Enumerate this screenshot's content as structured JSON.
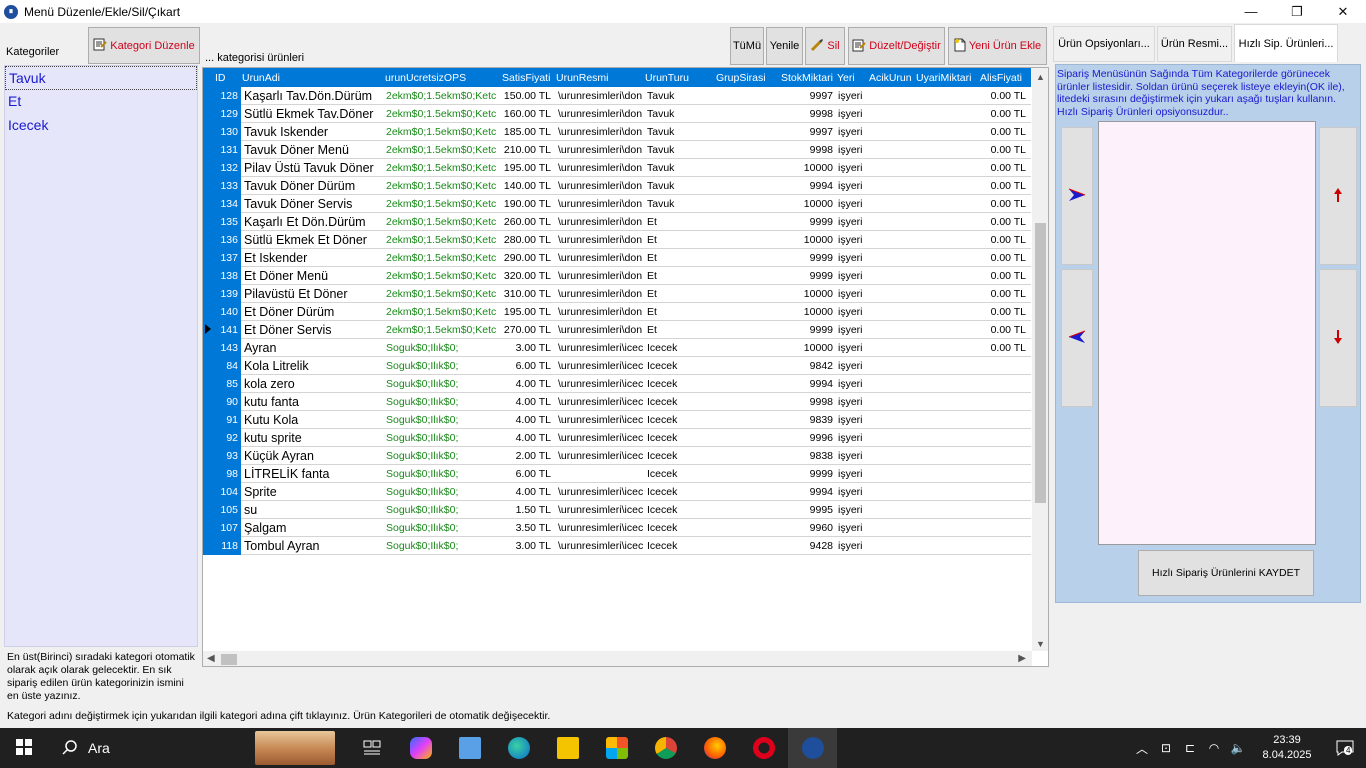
{
  "window": {
    "title": "Menü Düzenle/Ekle/Sil/Çıkart",
    "minimize": "—",
    "maximize": "❐",
    "close": "✕"
  },
  "left": {
    "label": "Kategoriler",
    "edit_button": "Kategori Düzenle",
    "categories": [
      "Tavuk",
      "Et",
      "Icecek"
    ],
    "note": "En üst(Birinci) sıradaki kategori otomatik olarak açık olarak gelecektir. En sık sipariş edilen ürün kategorinizin ismini en üste yazınız."
  },
  "products_label": "... kategorisi ürünleri",
  "toolbar": {
    "all": "TüMü",
    "refresh": "Yenile",
    "delete": "Sil",
    "edit": "Düzelt/Değiştir",
    "add": "Yeni Ürün Ekle"
  },
  "grid": {
    "columns": [
      "ID",
      "UrunAdi",
      "urunUcretsizOPS",
      "SatisFiyati",
      "UrunResmi",
      "UrunTuru",
      "GrupSirasi",
      "StokMiktari",
      "Yeri",
      "AcikUrun",
      "UyariMiktari",
      "AlisFiyati"
    ],
    "rows": [
      {
        "id": "128",
        "name": "Kaşarlı Tav.Dön.Dürüm",
        "ops": "2ekm$0;1.5ekm$0;Ketc",
        "price": "150.00 TL",
        "res": "\\urunresimleri\\don",
        "turu": "Tavuk",
        "stok": "9997",
        "yeri": "işyeri",
        "alis": "0.00 TL"
      },
      {
        "id": "129",
        "name": "Sütlü Ekmek Tav.Döner",
        "ops": "2ekm$0;1.5ekm$0;Ketc",
        "price": "160.00 TL",
        "res": "\\urunresimleri\\don",
        "turu": "Tavuk",
        "stok": "9998",
        "yeri": "işyeri",
        "alis": "0.00 TL"
      },
      {
        "id": "130",
        "name": "Tavuk Iskender",
        "ops": "2ekm$0;1.5ekm$0;Ketc",
        "price": "185.00 TL",
        "res": "\\urunresimleri\\don",
        "turu": "Tavuk",
        "stok": "9997",
        "yeri": "işyeri",
        "alis": "0.00 TL"
      },
      {
        "id": "131",
        "name": "Tavuk Döner Menü",
        "ops": "2ekm$0;1.5ekm$0;Ketc",
        "price": "210.00 TL",
        "res": "\\urunresimleri\\don",
        "turu": "Tavuk",
        "stok": "9998",
        "yeri": "işyeri",
        "alis": "0.00 TL"
      },
      {
        "id": "132",
        "name": "Pilav Üstü Tavuk Döner",
        "ops": "2ekm$0;1.5ekm$0;Ketc",
        "price": "195.00 TL",
        "res": "\\urunresimleri\\don",
        "turu": "Tavuk",
        "stok": "10000",
        "yeri": "işyeri",
        "alis": "0.00 TL"
      },
      {
        "id": "133",
        "name": "Tavuk Döner Dürüm",
        "ops": "2ekm$0;1.5ekm$0;Ketc",
        "price": "140.00 TL",
        "res": "\\urunresimleri\\don",
        "turu": "Tavuk",
        "stok": "9994",
        "yeri": "işyeri",
        "alis": "0.00 TL"
      },
      {
        "id": "134",
        "name": "Tavuk Döner Servis",
        "ops": "2ekm$0;1.5ekm$0;Ketc",
        "price": "190.00 TL",
        "res": "\\urunresimleri\\don",
        "turu": "Tavuk",
        "stok": "10000",
        "yeri": "işyeri",
        "alis": "0.00 TL"
      },
      {
        "id": "135",
        "name": "Kaşarlı Et Dön.Dürüm",
        "ops": "2ekm$0;1.5ekm$0;Ketc",
        "price": "260.00 TL",
        "res": "\\urunresimleri\\don",
        "turu": "Et",
        "stok": "9999",
        "yeri": "işyeri",
        "alis": "0.00 TL"
      },
      {
        "id": "136",
        "name": "Sütlü Ekmek Et Döner",
        "ops": "2ekm$0;1.5ekm$0;Ketc",
        "price": "280.00 TL",
        "res": "\\urunresimleri\\don",
        "turu": "Et",
        "stok": "10000",
        "yeri": "işyeri",
        "alis": "0.00 TL"
      },
      {
        "id": "137",
        "name": "Et Iskender",
        "ops": "2ekm$0;1.5ekm$0;Ketc",
        "price": "290.00 TL",
        "res": "\\urunresimleri\\don",
        "turu": "Et",
        "stok": "9999",
        "yeri": "işyeri",
        "alis": "0.00 TL"
      },
      {
        "id": "138",
        "name": "Et Döner Menü",
        "ops": "2ekm$0;1.5ekm$0;Ketc",
        "price": "320.00 TL",
        "res": "\\urunresimleri\\don",
        "turu": "Et",
        "stok": "9999",
        "yeri": "işyeri",
        "alis": "0.00 TL"
      },
      {
        "id": "139",
        "name": "Pilavüstü Et Döner",
        "ops": "2ekm$0;1.5ekm$0;Ketc",
        "price": "310.00 TL",
        "res": "\\urunresimleri\\don",
        "turu": "Et",
        "stok": "10000",
        "yeri": "işyeri",
        "alis": "0.00 TL"
      },
      {
        "id": "140",
        "name": "Et Döner Dürüm",
        "ops": "2ekm$0;1.5ekm$0;Ketc",
        "price": "195.00 TL",
        "res": "\\urunresimleri\\don",
        "turu": "Et",
        "stok": "10000",
        "yeri": "işyeri",
        "alis": "0.00 TL"
      },
      {
        "id": "141",
        "name": "Et Döner Servis",
        "ops": "2ekm$0;1.5ekm$0;Ketc",
        "price": "270.00 TL",
        "res": "\\urunresimleri\\don",
        "turu": "Et",
        "stok": "9999",
        "yeri": "işyeri",
        "alis": "0.00 TL",
        "current": true
      },
      {
        "id": "143",
        "name": "Ayran",
        "ops": "Soguk$0;Ilık$0;",
        "price": "3.00 TL",
        "res": "\\urunresimleri\\icec",
        "turu": "Icecek",
        "stok": "10000",
        "yeri": "işyeri",
        "alis": "0.00 TL"
      },
      {
        "id": "84",
        "name": "Kola Litrelik",
        "ops": "Soguk$0;Ilık$0;",
        "price": "6.00 TL",
        "res": "\\urunresimleri\\icec",
        "turu": "Icecek",
        "stok": "9842",
        "yeri": "işyeri",
        "alis": ""
      },
      {
        "id": "85",
        "name": "kola zero",
        "ops": "Soguk$0;Ilık$0;",
        "price": "4.00 TL",
        "res": "\\urunresimleri\\icec",
        "turu": "Icecek",
        "stok": "9994",
        "yeri": "işyeri",
        "alis": ""
      },
      {
        "id": "90",
        "name": "kutu fanta",
        "ops": "Soguk$0;Ilık$0;",
        "price": "4.00 TL",
        "res": "\\urunresimleri\\icec",
        "turu": "Icecek",
        "stok": "9998",
        "yeri": "işyeri",
        "alis": ""
      },
      {
        "id": "91",
        "name": "Kutu Kola",
        "ops": "Soguk$0;Ilık$0;",
        "price": "4.00 TL",
        "res": "\\urunresimleri\\icec",
        "turu": "Icecek",
        "stok": "9839",
        "yeri": "işyeri",
        "alis": ""
      },
      {
        "id": "92",
        "name": "kutu sprite",
        "ops": "Soguk$0;Ilık$0;",
        "price": "4.00 TL",
        "res": "\\urunresimleri\\icec",
        "turu": "Icecek",
        "stok": "9996",
        "yeri": "işyeri",
        "alis": ""
      },
      {
        "id": "93",
        "name": "Küçük Ayran",
        "ops": "Soguk$0;Ilık$0;",
        "price": "2.00 TL",
        "res": "\\urunresimleri\\icec",
        "turu": "Icecek",
        "stok": "9838",
        "yeri": "işyeri",
        "alis": ""
      },
      {
        "id": "98",
        "name": "LİTRELİK fanta",
        "ops": "Soguk$0;Ilık$0;",
        "price": "6.00 TL",
        "res": "",
        "turu": "Icecek",
        "stok": "9999",
        "yeri": "işyeri",
        "alis": ""
      },
      {
        "id": "104",
        "name": "Sprite",
        "ops": "Soguk$0;Ilık$0;",
        "price": "4.00 TL",
        "res": "\\urunresimleri\\icec",
        "turu": "Icecek",
        "stok": "9994",
        "yeri": "işyeri",
        "alis": ""
      },
      {
        "id": "105",
        "name": "su",
        "ops": "Soguk$0;Ilık$0;",
        "price": "1.50 TL",
        "res": "\\urunresimleri\\icec",
        "turu": "Icecek",
        "stok": "9995",
        "yeri": "işyeri",
        "alis": ""
      },
      {
        "id": "107",
        "name": "Şalgam",
        "ops": "Soguk$0;Ilık$0;",
        "price": "3.50 TL",
        "res": "\\urunresimleri\\icec",
        "turu": "Icecek",
        "stok": "9960",
        "yeri": "işyeri",
        "alis": ""
      },
      {
        "id": "118",
        "name": "Tombul Ayran",
        "ops": "Soguk$0;Ilık$0;",
        "price": "3.00 TL",
        "res": "\\urunresimleri\\icec",
        "turu": "Icecek",
        "stok": "9428",
        "yeri": "işyeri",
        "alis": ""
      }
    ]
  },
  "tabs": [
    "Ürün Opsiyonları...",
    "Ürün Resmi...",
    "Hızlı Sip. Ürünleri..."
  ],
  "right": {
    "description": "Sipariş Menüsünün Sağında Tüm Kategorilerde görünecek ürünler listesidir. Soldan ürünü seçerek listeye ekleyin(OK ile), litedeki sırasını değiştirmek için yukarı aşağı tuşları kullanın. Hızlı Sipariş Ürünleri opsiyonsuzdur..",
    "save_button": "Hızlı Sipariş Ürünlerini KAYDET"
  },
  "footer_note": "Kategori adını değiştirmek için yukarıdan ilgili kategori adına çift tıklayınız. Ürün Kategorileri de otomatik değişecektir.",
  "taskbar": {
    "search": "Ara",
    "time": "23:39",
    "date": "8.04.2025",
    "notifications": "4"
  },
  "colors": {
    "grid_header": "#0078d7",
    "category_bg": "#e6e6fa",
    "right_panel": "#b8d0ea",
    "ops_text": "#1a8a1a",
    "red_label": "#d0021b"
  }
}
